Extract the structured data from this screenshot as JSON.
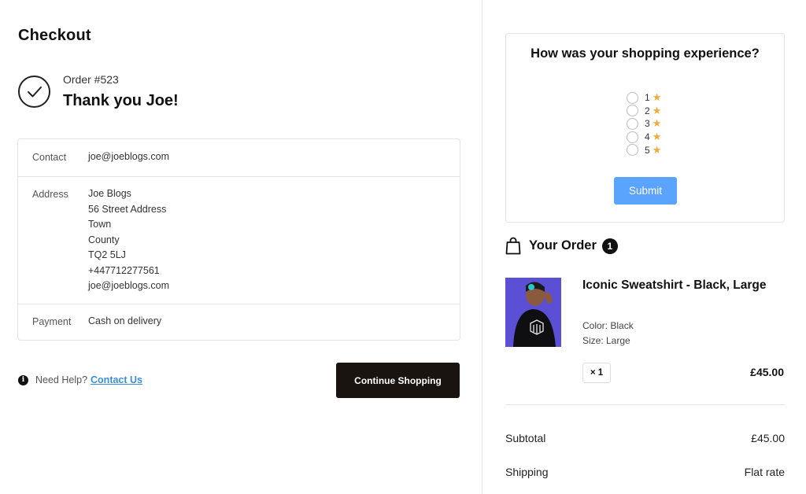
{
  "checkout": {
    "title": "Checkout",
    "order_number": "Order #523",
    "thank_you": "Thank you Joe!"
  },
  "info": {
    "contact": {
      "label": "Contact",
      "value": "joe@joeblogs.com"
    },
    "address": {
      "label": "Address",
      "lines": [
        "Joe Blogs",
        "56 Street Address",
        "Town",
        "County",
        "TQ2 5LJ",
        "+447712277561",
        "joe@joeblogs.com"
      ]
    },
    "payment": {
      "label": "Payment",
      "value": "Cash on delivery"
    }
  },
  "help": {
    "text": "Need Help?",
    "link": "Contact Us"
  },
  "continue_button": "Continue Shopping",
  "survey": {
    "question": "How was your shopping experience?",
    "options": [
      "1",
      "2",
      "3",
      "4",
      "5"
    ],
    "submit_label": "Submit"
  },
  "order": {
    "title": "Your Order",
    "count": "1",
    "item": {
      "name": "Iconic Sweatshirt - Black, Large",
      "color": "Color: Black",
      "size": "Size: Large",
      "quantity": "× 1",
      "price": "£45.00"
    },
    "subtotal_label": "Subtotal",
    "subtotal_value": "£45.00",
    "shipping_label": "Shipping",
    "shipping_value": "Flat rate"
  },
  "colors": {
    "accent_button": "#1a1410",
    "submit_button": "#5aa3ff",
    "star": "#f4a83a",
    "link": "#3a8fd8"
  },
  "icons": [
    "check-icon",
    "info-icon",
    "star-icon",
    "shopping-bag-icon"
  ]
}
